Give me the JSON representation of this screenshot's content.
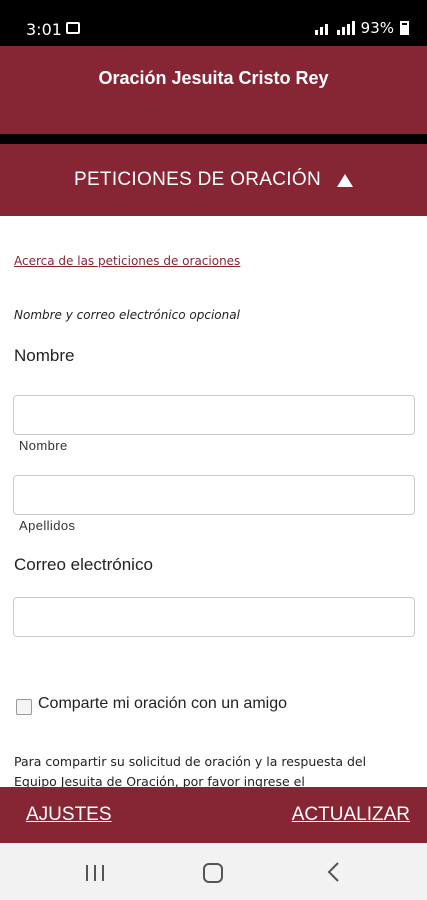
{
  "status_bar": {
    "time": "3:01",
    "battery_text": "93%",
    "icons": [
      "image-icon",
      "wifi-icon",
      "signal-icon",
      "battery-icon"
    ]
  },
  "header": {
    "title": "Oración Jesuita Cristo Rey"
  },
  "section": {
    "title": "PETICIONES DE ORACIÓN",
    "expanded": true
  },
  "form": {
    "about_link": "Acerca de las peticiones de oraciones",
    "optional_note": "Nombre y correo electrónico opcional",
    "name_heading": "Nombre",
    "first_name_value": "",
    "first_name_label": "Nombre",
    "last_name_value": "",
    "last_name_label": "Apellidos",
    "email_heading": "Correo electrónico",
    "email_value": "",
    "share_checkbox_label": "Comparte mi oración con un amigo",
    "share_checked": false,
    "paragraph": "Para compartir su solicitud de oración y la respuesta del Equipo Jesuita de Oración, por favor ingrese el"
  },
  "bottom_bar": {
    "left_label": "AJUSTES",
    "right_label": "ACTUALIZAR"
  },
  "colors": {
    "brand": "#862634",
    "status_bar": "#000000",
    "nav_bar": "#f2f2f2"
  }
}
